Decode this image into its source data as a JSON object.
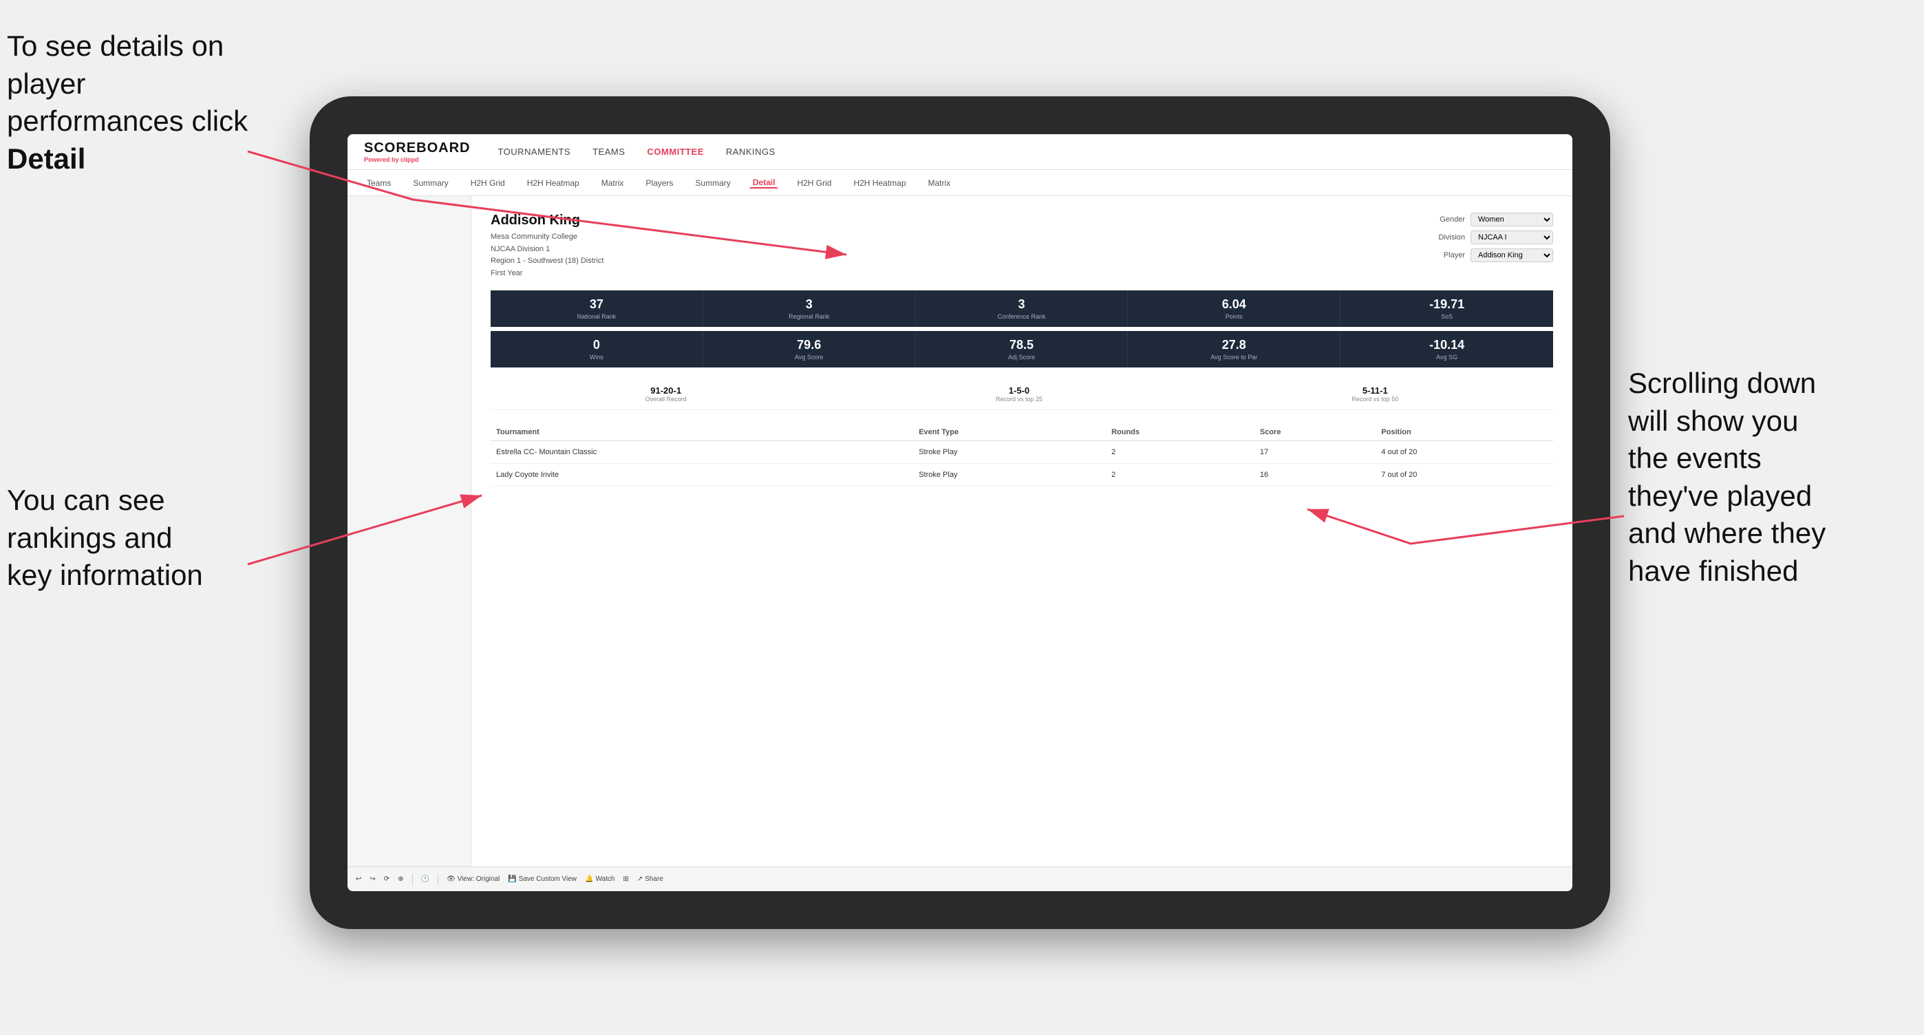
{
  "annotations": {
    "topleft": "To see details on player performances click ",
    "topleft_bold": "Detail",
    "bottomleft_line1": "You can see",
    "bottomleft_line2": "rankings and",
    "bottomleft_line3": "key information",
    "right_line1": "Scrolling down",
    "right_line2": "will show you",
    "right_line3": "the events",
    "right_line4": "they've played",
    "right_line5": "and where they",
    "right_line6": "have finished"
  },
  "topnav": {
    "logo": "SCOREBOARD",
    "powered_by": "Powered by ",
    "powered_brand": "clippd",
    "items": [
      {
        "label": "TOURNAMENTS",
        "active": false
      },
      {
        "label": "TEAMS",
        "active": false
      },
      {
        "label": "COMMITTEE",
        "active": true
      },
      {
        "label": "RANKINGS",
        "active": false
      }
    ]
  },
  "subnav": {
    "items": [
      {
        "label": "Teams",
        "active": false
      },
      {
        "label": "Summary",
        "active": false
      },
      {
        "label": "H2H Grid",
        "active": false
      },
      {
        "label": "H2H Heatmap",
        "active": false
      },
      {
        "label": "Matrix",
        "active": false
      },
      {
        "label": "Players",
        "active": false
      },
      {
        "label": "Summary",
        "active": false
      },
      {
        "label": "Detail",
        "active": true
      },
      {
        "label": "H2H Grid",
        "active": false
      },
      {
        "label": "H2H Heatmap",
        "active": false
      },
      {
        "label": "Matrix",
        "active": false
      }
    ]
  },
  "player": {
    "name": "Addison King",
    "college": "Mesa Community College",
    "division": "NJCAA Division 1",
    "region": "Region 1 - Southwest (18) District",
    "year": "First Year",
    "gender_label": "Gender",
    "gender_value": "Women",
    "division_label": "Division",
    "division_value": "NJCAA I",
    "player_label": "Player",
    "player_value": "Addison King"
  },
  "stats_row1": [
    {
      "value": "37",
      "label": "National Rank"
    },
    {
      "value": "3",
      "label": "Regional Rank"
    },
    {
      "value": "3",
      "label": "Conference Rank"
    },
    {
      "value": "6.04",
      "label": "Points"
    },
    {
      "value": "-19.71",
      "label": "SoS"
    }
  ],
  "stats_row2": [
    {
      "value": "0",
      "label": "Wins"
    },
    {
      "value": "79.6",
      "label": "Avg Score"
    },
    {
      "value": "78.5",
      "label": "Adj Score"
    },
    {
      "value": "27.8",
      "label": "Avg Score to Par"
    },
    {
      "value": "-10.14",
      "label": "Avg SG"
    }
  ],
  "records": [
    {
      "value": "91-20-1",
      "label": "Overall Record"
    },
    {
      "value": "1-5-0",
      "label": "Record vs top 25"
    },
    {
      "value": "5-11-1",
      "label": "Record vs top 50"
    }
  ],
  "table": {
    "headers": [
      "Tournament",
      "Event Type",
      "Rounds",
      "Score",
      "Position"
    ],
    "rows": [
      {
        "tournament": "Estrella CC- Mountain Classic",
        "event_type": "Stroke Play",
        "rounds": "2",
        "score": "17",
        "position": "4 out of 20"
      },
      {
        "tournament": "Lady Coyote Invite",
        "event_type": "Stroke Play",
        "rounds": "2",
        "score": "16",
        "position": "7 out of 20"
      }
    ]
  },
  "toolbar": {
    "view_original": "View: Original",
    "save_custom": "Save Custom View",
    "watch": "Watch",
    "share": "Share"
  }
}
